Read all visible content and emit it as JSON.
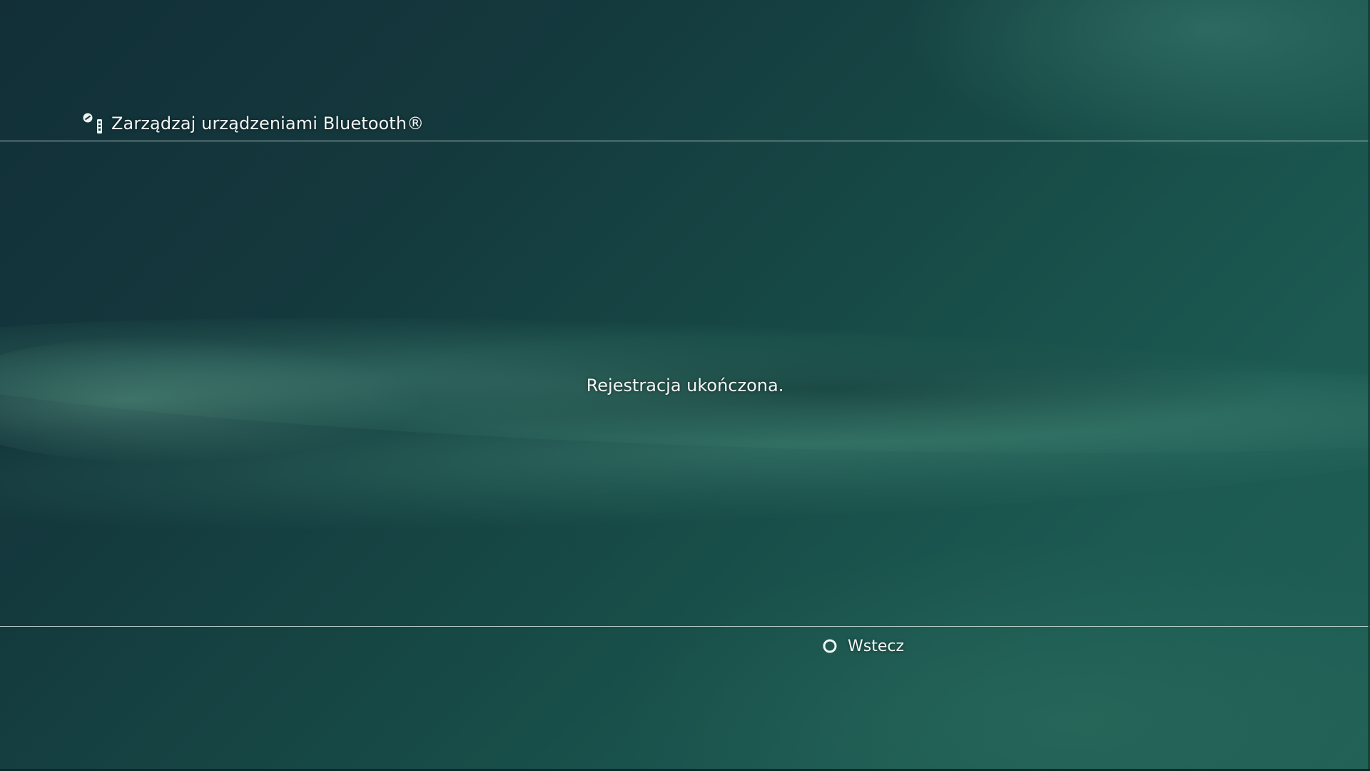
{
  "header": {
    "icon": "bluetooth-controller-settings-icon",
    "title": "Zarządzaj urządzeniami Bluetooth®"
  },
  "main": {
    "message": "Rejestracja ukończona."
  },
  "footer": {
    "back_button": {
      "icon": "circle-button-icon",
      "label": "Wstecz"
    }
  },
  "colors": {
    "text": "#f2f6f5",
    "background_dark": "#122f38",
    "background_light": "#1f5f55",
    "rule": "#dcebe6"
  }
}
